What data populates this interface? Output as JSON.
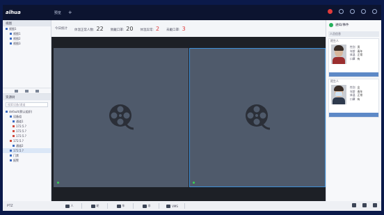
{
  "topbar": {
    "logo": "alhua",
    "tab_label": "预览",
    "tab_add": "+"
  },
  "stats": [
    {
      "label": "今日统计",
      "value": "",
      "red": false
    },
    {
      "label": "体温正常人数:",
      "value": "22",
      "red": false
    },
    {
      "label": "佩戴口罩:",
      "value": "20",
      "red": false
    },
    {
      "label": "体温异常:",
      "value": "2",
      "red": false
    },
    {
      "label": "未戴口罩:",
      "value": "3",
      "red": true
    }
  ],
  "stat_red_index_2": true,
  "left": {
    "device_title": "视图",
    "tree": [
      {
        "label": "视图1",
        "level": 0,
        "selected": false
      },
      {
        "label": "视图1",
        "level": 1,
        "selected": false
      },
      {
        "label": "视图2",
        "level": 1,
        "selected": false
      },
      {
        "label": "视图3",
        "level": 1,
        "selected": false
      }
    ],
    "resource_title": "资源树",
    "search_placeholder": "搜索设备/通道",
    "devices": [
      {
        "label": "default(默认组织)",
        "level": 0,
        "red": false,
        "selected": false
      },
      {
        "label": "设备组",
        "level": 1,
        "red": false,
        "selected": false
      },
      {
        "label": "通道1",
        "level": 2,
        "red": false,
        "selected": false
      },
      {
        "label": "172.5.?",
        "level": 2,
        "red": true,
        "selected": false
      },
      {
        "label": "172.5.?",
        "level": 2,
        "red": true,
        "selected": false
      },
      {
        "label": "172.5.?",
        "level": 2,
        "red": true,
        "selected": false
      },
      {
        "label": "172.5.?",
        "level": 1,
        "red": true,
        "selected": false
      },
      {
        "label": "通道2",
        "level": 2,
        "red": false,
        "selected": false
      },
      {
        "label": "172.5.?",
        "level": 1,
        "red": false,
        "selected": true
      },
      {
        "label": "门禁",
        "level": 1,
        "red": false,
        "selected": false
      },
      {
        "label": "报警",
        "level": 1,
        "red": false,
        "selected": false
      }
    ],
    "bottom_label": "PTZ"
  },
  "bottombar": {
    "buttons": [
      "人",
      "轮",
      "车",
      "非",
      "VMS"
    ]
  },
  "right": {
    "title": "通知/事件",
    "subheader": "人员信息",
    "cards": [
      {
        "title": "陌生人",
        "fields": [
          [
            "性别",
            "男"
          ],
          [
            "年龄",
            "青年"
          ],
          [
            "体温",
            "正常"
          ],
          [
            "口罩",
            "有"
          ]
        ]
      },
      {
        "title": "陌生人",
        "fields": [
          [
            "性别",
            "女"
          ],
          [
            "年龄",
            "青年"
          ],
          [
            "体温",
            "正常"
          ],
          [
            "口罩",
            "有"
          ]
        ]
      }
    ]
  },
  "colors": {
    "accent": "#3e8fd6",
    "danger": "#e03a3a",
    "ok": "#24b05a"
  }
}
